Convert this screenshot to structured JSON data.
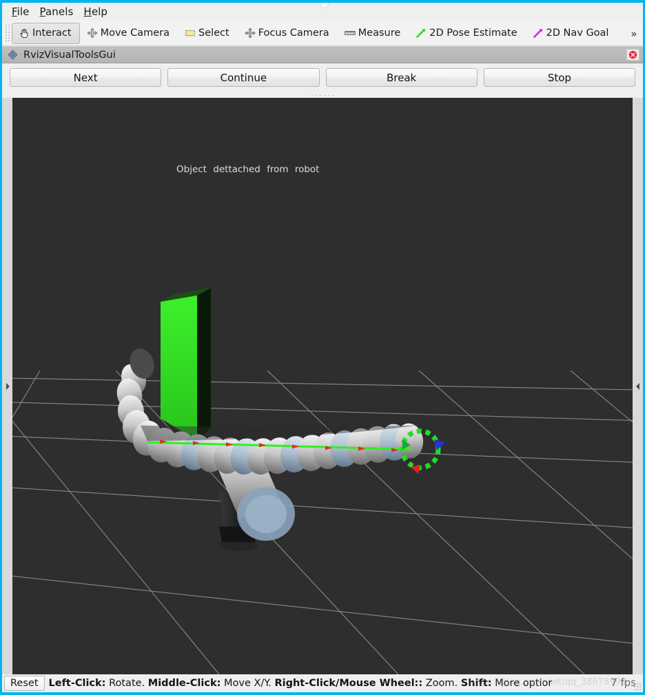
{
  "window": {
    "accent_color": "#00b4f0",
    "background": "#efefef"
  },
  "menubar": {
    "items": [
      {
        "name": "file",
        "accel": "F",
        "rest": "ile"
      },
      {
        "name": "panels",
        "accel": "P",
        "rest": "anels"
      },
      {
        "name": "help",
        "accel": "H",
        "rest": "elp"
      }
    ]
  },
  "toolbar": {
    "items": [
      {
        "label": "Interact",
        "icon": "hand-cursor-icon",
        "checked": true
      },
      {
        "label": "Move Camera",
        "icon": "move-camera-icon",
        "checked": false
      },
      {
        "label": "Select",
        "icon": "select-rect-icon",
        "checked": false
      },
      {
        "label": "Focus Camera",
        "icon": "focus-camera-icon",
        "checked": false
      },
      {
        "label": "Measure",
        "icon": "ruler-icon",
        "checked": false
      },
      {
        "label": "2D Pose Estimate",
        "icon": "green-arrow-icon",
        "checked": false
      },
      {
        "label": "2D Nav Goal",
        "icon": "magenta-arrow-icon",
        "checked": false
      }
    ],
    "overflow_label": "»"
  },
  "panel": {
    "title": "RvizVisualToolsGui",
    "icon": "rviz-diamond-icon",
    "close_icon": "close-icon",
    "buttons": [
      {
        "label": "Next"
      },
      {
        "label": "Continue"
      },
      {
        "label": "Break"
      },
      {
        "label": "Stop"
      }
    ]
  },
  "viewport": {
    "background_color": "#2e2e2e",
    "grid_color": "#9a9a9a",
    "overlay_text": "Object  dettached  from  robot",
    "object_color": "#33dd22",
    "left_handle_icon": "expand-right-icon",
    "right_handle_icon": "expand-left-icon"
  },
  "statusbar": {
    "reset_label": "Reset",
    "help_segments": [
      {
        "text": "Left-Click:",
        "bold": true
      },
      {
        "text": " Rotate. ",
        "bold": false
      },
      {
        "text": "Middle-Click:",
        "bold": true
      },
      {
        "text": " Move X/Y. ",
        "bold": false
      },
      {
        "text": "Right-Click/Mouse Wheel::",
        "bold": true
      },
      {
        "text": " Zoom. ",
        "bold": false
      },
      {
        "text": "Shift:",
        "bold": true
      },
      {
        "text": " More optior",
        "bold": false
      }
    ],
    "fps": "7 fps",
    "watermark": "https://blog.csdn.net/qq_38678999"
  }
}
